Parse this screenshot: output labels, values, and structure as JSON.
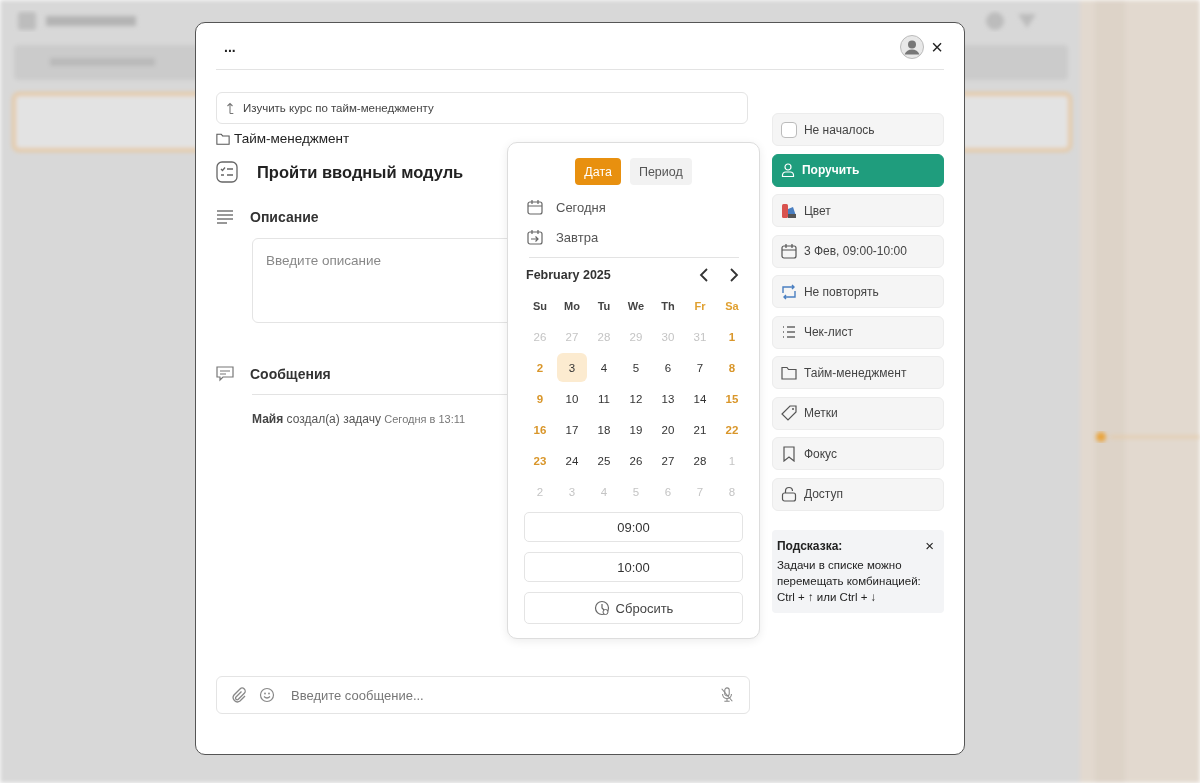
{
  "modal": {
    "menu": "...",
    "close": "×"
  },
  "parent_task": "Изучить курс по тайм-менеджменту",
  "project": "Тайм-менеджмент",
  "title": "Пройти вводный модуль",
  "description": {
    "heading": "Описание",
    "placeholder": "Введите описание"
  },
  "messages": {
    "heading": "Сообщения",
    "log": [
      {
        "author": "Майя",
        "action": "создал(а) задачу",
        "time": "Сегодня в 13:11"
      }
    ]
  },
  "composer": {
    "placeholder": "Введите сообщение..."
  },
  "date_picker": {
    "modes": [
      {
        "label": "Дата",
        "selected": true
      },
      {
        "label": "Период",
        "selected": false
      }
    ],
    "shortcuts": [
      {
        "label": "Сегодня",
        "kind": "today"
      },
      {
        "label": "Завтра",
        "kind": "tomorrow"
      }
    ],
    "month": "February 2025",
    "weekdays": [
      {
        "label": "Su",
        "weekend": false
      },
      {
        "label": "Mo",
        "weekend": false
      },
      {
        "label": "Tu",
        "weekend": false
      },
      {
        "label": "We",
        "weekend": false
      },
      {
        "label": "Th",
        "weekend": false
      },
      {
        "label": "Fr",
        "weekend": true
      },
      {
        "label": "Sa",
        "weekend": true
      }
    ],
    "weeks": [
      [
        {
          "d": "26",
          "kind": "outside",
          "selected": false
        },
        {
          "d": "27",
          "kind": "outside",
          "selected": false
        },
        {
          "d": "28",
          "kind": "outside",
          "selected": false
        },
        {
          "d": "29",
          "kind": "outside",
          "selected": false
        },
        {
          "d": "30",
          "kind": "outside",
          "selected": false
        },
        {
          "d": "31",
          "kind": "outside",
          "selected": false
        },
        {
          "d": "1",
          "kind": "weekend",
          "selected": false
        }
      ],
      [
        {
          "d": "2",
          "kind": "weekend",
          "selected": false
        },
        {
          "d": "3",
          "kind": "day",
          "selected": true
        },
        {
          "d": "4",
          "kind": "day",
          "selected": false
        },
        {
          "d": "5",
          "kind": "day",
          "selected": false
        },
        {
          "d": "6",
          "kind": "day",
          "selected": false
        },
        {
          "d": "7",
          "kind": "day",
          "selected": false
        },
        {
          "d": "8",
          "kind": "weekend",
          "selected": false
        }
      ],
      [
        {
          "d": "9",
          "kind": "weekend",
          "selected": false
        },
        {
          "d": "10",
          "kind": "day",
          "selected": false
        },
        {
          "d": "11",
          "kind": "day",
          "selected": false
        },
        {
          "d": "12",
          "kind": "day",
          "selected": false
        },
        {
          "d": "13",
          "kind": "day",
          "selected": false
        },
        {
          "d": "14",
          "kind": "day",
          "selected": false
        },
        {
          "d": "15",
          "kind": "weekend",
          "selected": false
        }
      ],
      [
        {
          "d": "16",
          "kind": "weekend",
          "selected": false
        },
        {
          "d": "17",
          "kind": "day",
          "selected": false
        },
        {
          "d": "18",
          "kind": "day",
          "selected": false
        },
        {
          "d": "19",
          "kind": "day",
          "selected": false
        },
        {
          "d": "20",
          "kind": "day",
          "selected": false
        },
        {
          "d": "21",
          "kind": "day",
          "selected": false
        },
        {
          "d": "22",
          "kind": "weekend",
          "selected": false
        }
      ],
      [
        {
          "d": "23",
          "kind": "weekend",
          "selected": false
        },
        {
          "d": "24",
          "kind": "day",
          "selected": false
        },
        {
          "d": "25",
          "kind": "day",
          "selected": false
        },
        {
          "d": "26",
          "kind": "day",
          "selected": false
        },
        {
          "d": "27",
          "kind": "day",
          "selected": false
        },
        {
          "d": "28",
          "kind": "day",
          "selected": false
        },
        {
          "d": "1",
          "kind": "outside",
          "selected": false
        }
      ],
      [
        {
          "d": "2",
          "kind": "outside",
          "selected": false
        },
        {
          "d": "3",
          "kind": "outside",
          "selected": false
        },
        {
          "d": "4",
          "kind": "outside",
          "selected": false
        },
        {
          "d": "5",
          "kind": "outside",
          "selected": false
        },
        {
          "d": "6",
          "kind": "outside",
          "selected": false
        },
        {
          "d": "7",
          "kind": "outside",
          "selected": false
        },
        {
          "d": "8",
          "kind": "outside",
          "selected": false
        }
      ]
    ],
    "start_time": "09:00",
    "end_time": "10:00",
    "reset": "Сбросить"
  },
  "actions": [
    {
      "label": "Не началось",
      "kind": "status",
      "checked": false
    },
    {
      "label": "Поручить",
      "kind": "assign"
    },
    {
      "label": "Цвет",
      "kind": "color"
    },
    {
      "label": "3 Фев, 09:00-10:00",
      "kind": "date"
    },
    {
      "label": "Не повторять",
      "kind": "repeat"
    },
    {
      "label": "Чек-лист",
      "kind": "checklist"
    },
    {
      "label": "Тайм-менеджмент",
      "kind": "folder"
    },
    {
      "label": "Метки",
      "kind": "tags"
    },
    {
      "label": "Фокус",
      "kind": "focus"
    },
    {
      "label": "Доступ",
      "kind": "access"
    }
  ],
  "hint": {
    "title": "Подсказка:",
    "text": "Задачи в списке можно перемещать комбинацией: Ctrl + ↑ или Ctrl + ↓",
    "close": "×"
  }
}
